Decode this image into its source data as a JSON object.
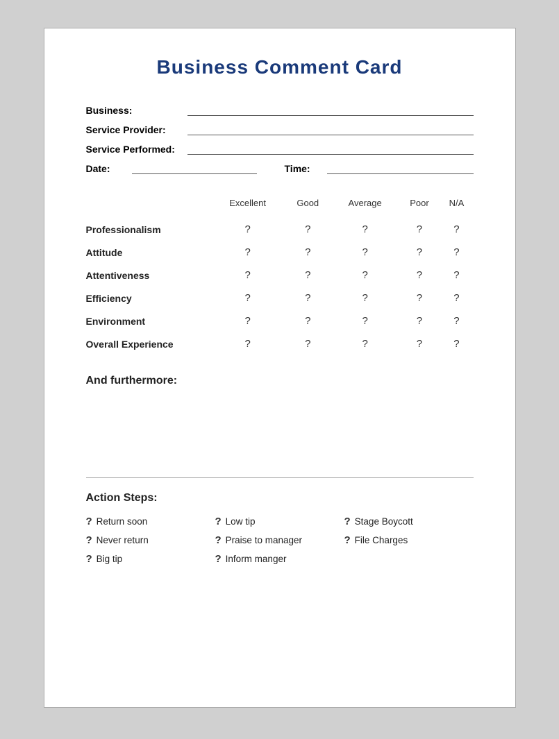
{
  "title": "Business Comment Card",
  "fields": {
    "business_label": "Business:",
    "service_provider_label": "Service Provider:",
    "service_performed_label": "Service Performed:",
    "date_label": "Date:",
    "time_label": "Time:"
  },
  "ratings": {
    "headers": [
      "",
      "Excellent",
      "Good",
      "Average",
      "Poor",
      "N/A"
    ],
    "rows": [
      {
        "label": "Professionalism",
        "values": [
          "?",
          "?",
          "?",
          "?",
          "?"
        ]
      },
      {
        "label": "Attitude",
        "values": [
          "?",
          "?",
          "?",
          "?",
          "?"
        ]
      },
      {
        "label": "Attentiveness",
        "values": [
          "?",
          "?",
          "?",
          "?",
          "?"
        ]
      },
      {
        "label": "Efficiency",
        "values": [
          "?",
          "?",
          "?",
          "?",
          "?"
        ]
      },
      {
        "label": "Environment",
        "values": [
          "?",
          "?",
          "?",
          "?",
          "?"
        ]
      },
      {
        "label": "Overall Experience",
        "values": [
          "?",
          "?",
          "?",
          "?",
          "?"
        ]
      }
    ]
  },
  "furthermore_label": "And furthermore:",
  "action_steps_label": "Action Steps:",
  "action_items": [
    {
      "q": "?",
      "text": "Return soon"
    },
    {
      "q": "?",
      "text": "Low tip"
    },
    {
      "q": "?",
      "text": "Stage Boycott"
    },
    {
      "q": "?",
      "text": "Never return"
    },
    {
      "q": "?",
      "text": "Praise to manager"
    },
    {
      "q": "?",
      "text": "File Charges"
    },
    {
      "q": "?",
      "text": "Big tip"
    },
    {
      "q": "?",
      "text": "Inform manger"
    },
    {
      "q": "",
      "text": ""
    }
  ]
}
